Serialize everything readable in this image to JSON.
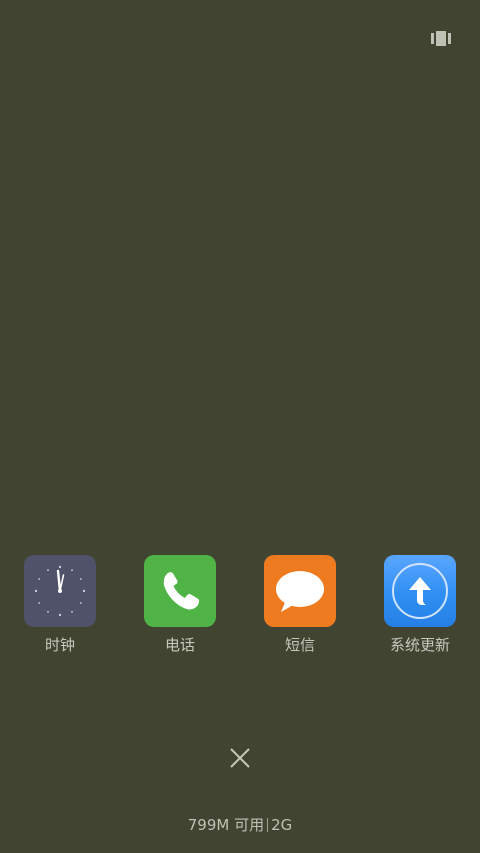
{
  "top_icon": "multi-window-toggle-icon",
  "apps": [
    {
      "label": "时钟",
      "icon": "clock-icon",
      "color": "#4f5268"
    },
    {
      "label": "电话",
      "icon": "phone-icon",
      "color": "#4fb445"
    },
    {
      "label": "短信",
      "icon": "message-icon",
      "color": "#ef7b21"
    },
    {
      "label": "系统更新",
      "icon": "update-arrow-icon",
      "color": "#2f8ff2"
    }
  ],
  "close_icon": "close-icon",
  "memory": {
    "available": "799M 可用",
    "total": "2G"
  }
}
